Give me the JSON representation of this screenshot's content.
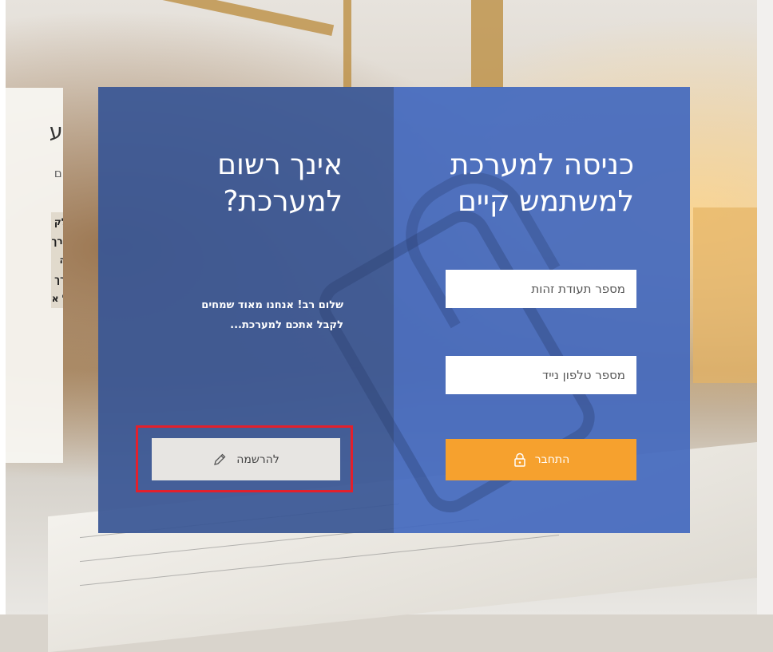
{
  "login": {
    "heading_line1": "כניסה למערכת",
    "heading_line2": "למשתמש קיים",
    "id_placeholder": "מספר תעודת זהות",
    "phone_placeholder": "מספר טלפון נייד",
    "login_button_label": "התחבר",
    "login_icon": "lock-icon"
  },
  "register": {
    "heading_line1": "אינך רשום",
    "heading_line2": "למערכת?",
    "welcome_line1": "שלום רב! אנחנו מאוד שמחים",
    "welcome_line2": "לקבל אתכם למערכת...",
    "register_button_label": "להרשמה",
    "register_icon": "pencil-icon"
  },
  "info_card": {
    "title_fragment": "מע",
    "subtitle_fragment": "שלום",
    "lines": [
      "כחלק",
      "העורך",
      "בניה",
      "מערך",
      "לכל א"
    ]
  },
  "colors": {
    "login_panel": "#4469be",
    "register_panel": "#395694",
    "login_button": "#f6a12e",
    "highlight_border": "#e3202c"
  }
}
